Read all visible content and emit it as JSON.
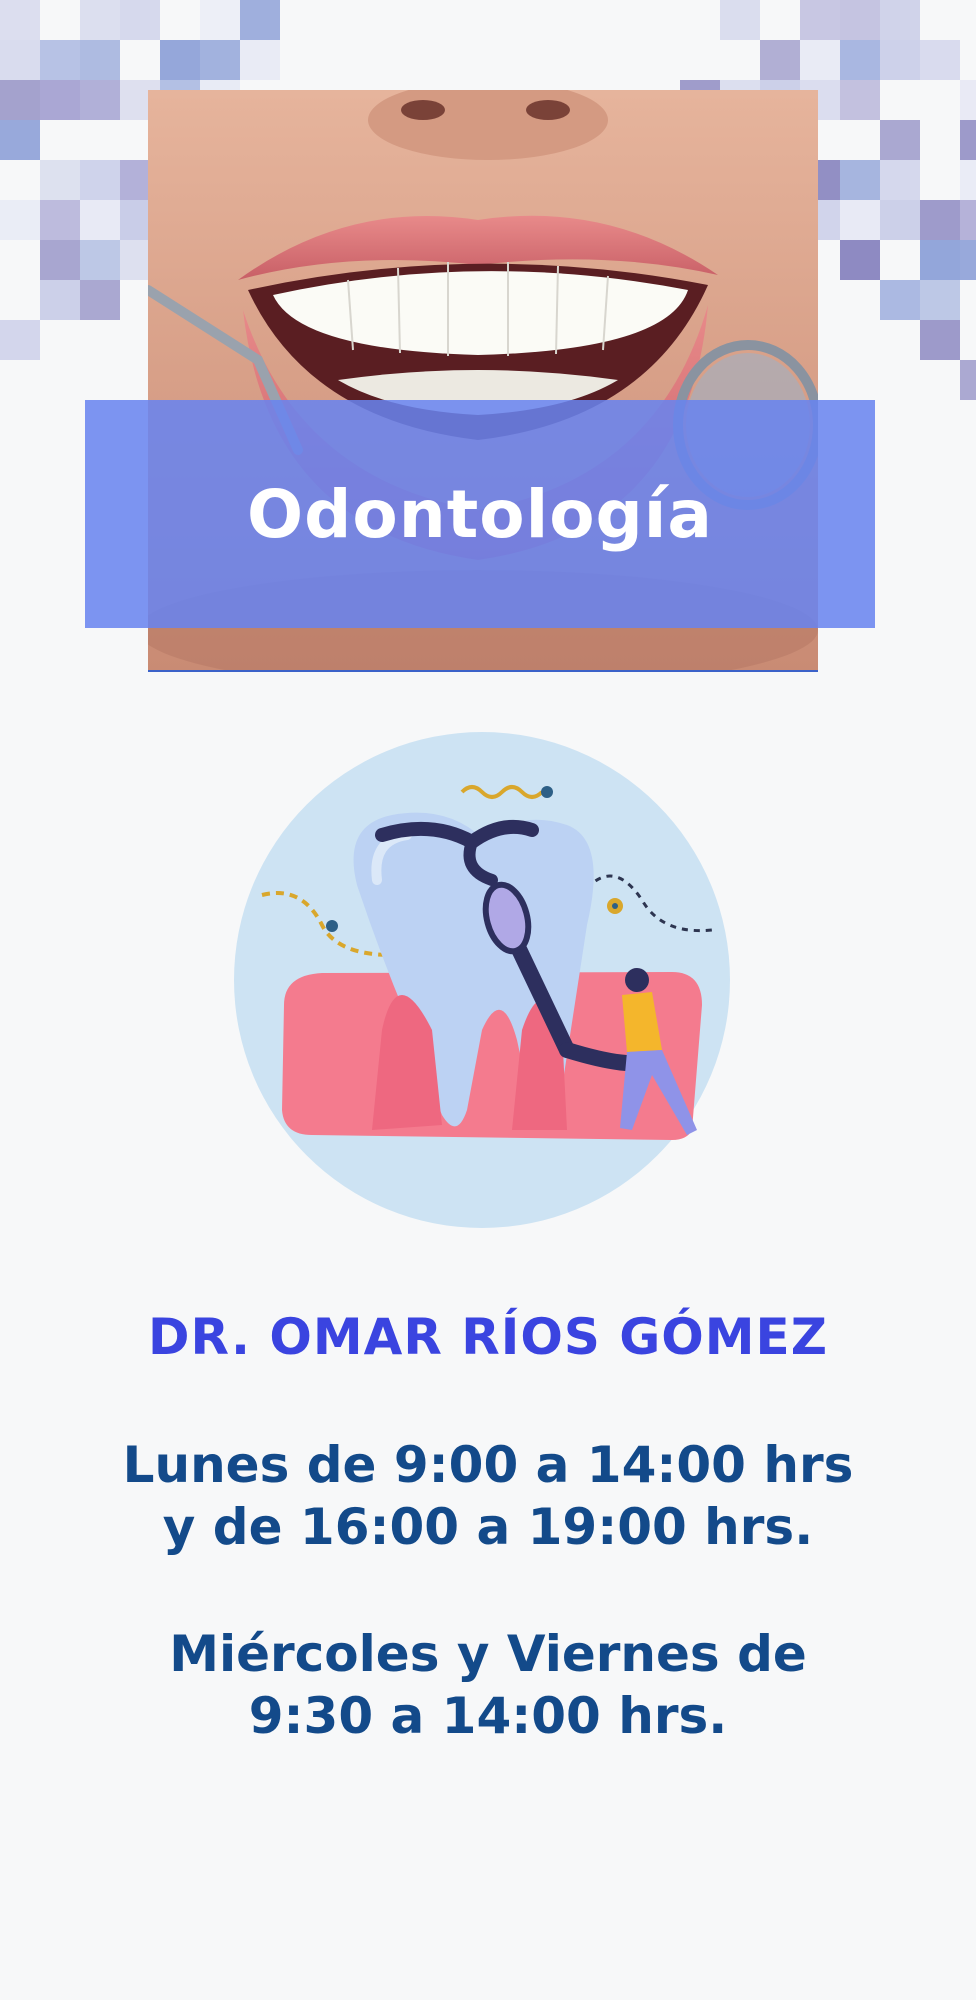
{
  "banner": {
    "title": "Odontología"
  },
  "doctor": {
    "name": "DR. OMAR RÍOS GÓMEZ"
  },
  "schedule": {
    "line1": "Lunes de 9:00 a 14:00 hrs",
    "line2": "y de 16:00 a 19:00 hrs.",
    "line3": "Miércoles y Viernes de",
    "line4": "9:30 a 14:00 hrs."
  },
  "colors": {
    "background": "#f7f8f9",
    "banner": "#6883f0",
    "doctor_name": "#3a44e0",
    "schedule_text": "#134a8a",
    "pixel_purple": "#7b77b8",
    "pixel_blue": "#8fa2d8",
    "illustration_circle": "#cde3f3",
    "gum": "#f47b8e",
    "tooth": "#bcd2f3"
  },
  "icons": {
    "photo": "smile-dental-mirror-photo",
    "illustration": "tooth-dentist-illustration"
  }
}
